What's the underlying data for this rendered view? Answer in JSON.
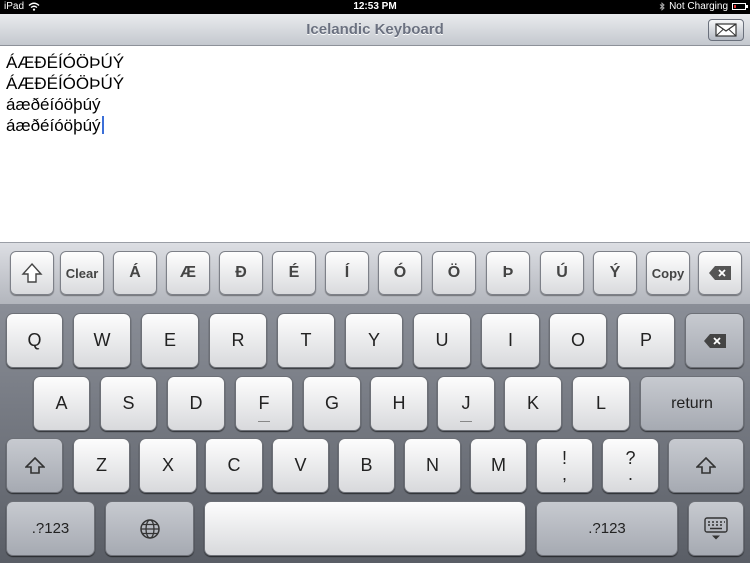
{
  "status": {
    "device": "iPad",
    "time": "12:53 PM",
    "charging": "Not Charging"
  },
  "nav": {
    "title": "Icelandic Keyboard"
  },
  "text_lines": [
    "ÁÆÐÉÍÓÖÞÚÝ",
    "ÁÆÐÉÍÓÖÞÚÝ",
    "áæðéíóöþúý",
    "áæðéíóöþúý"
  ],
  "accessory": {
    "clear": "Clear",
    "copy": "Copy",
    "letters": [
      "Á",
      "Æ",
      "Ð",
      "É",
      "Í",
      "Ó",
      "Ö",
      "Þ",
      "Ú",
      "Ý"
    ]
  },
  "keyboard": {
    "row1": [
      "Q",
      "W",
      "E",
      "R",
      "T",
      "Y",
      "U",
      "I",
      "O",
      "P"
    ],
    "row2": [
      "A",
      "S",
      "D",
      "F",
      "G",
      "H",
      "J",
      "K",
      "L"
    ],
    "row3": [
      "Z",
      "X",
      "C",
      "V",
      "B",
      "N",
      "M"
    ],
    "punct1_top": "!",
    "punct1_bottom": ",",
    "punct2_top": "?",
    "punct2_bottom": ".",
    "return": "return",
    "numbers": ".?123"
  },
  "colors": {
    "cursor": "#3b6fd8",
    "battery_low": "#e33333"
  },
  "battery_level": 0.15
}
